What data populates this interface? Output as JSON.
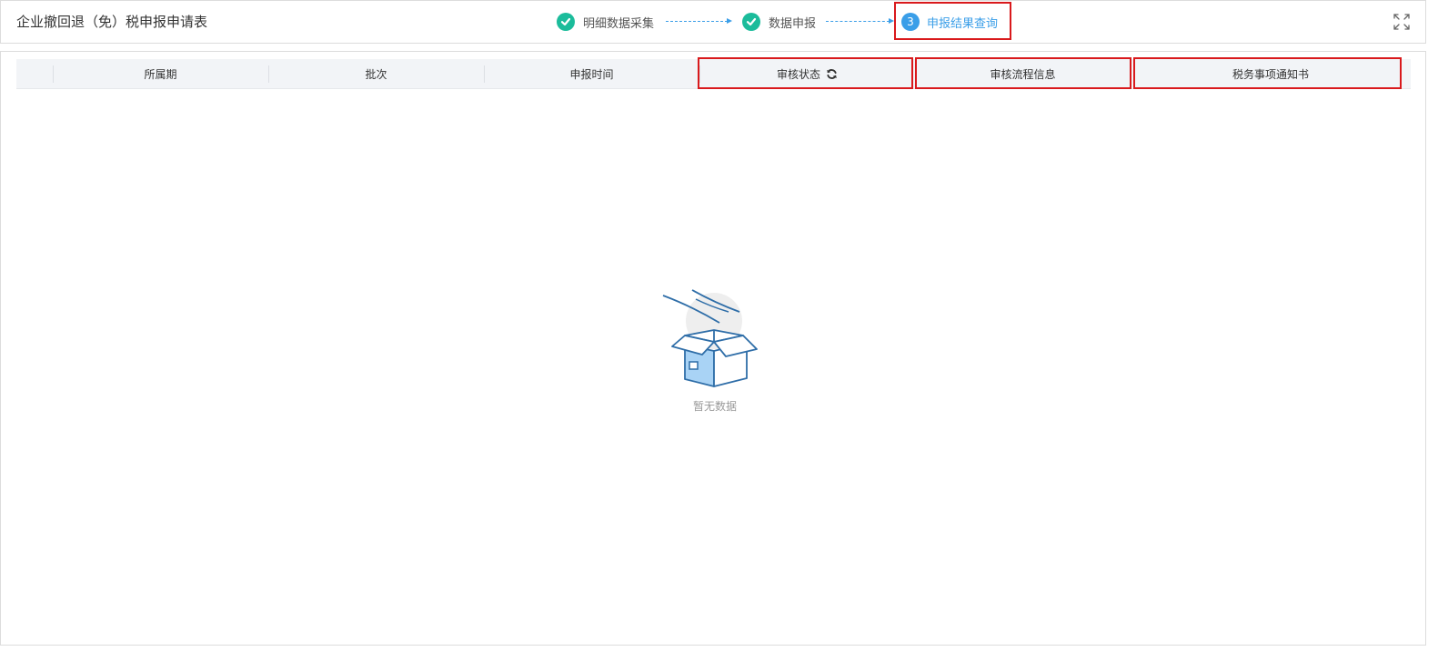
{
  "header": {
    "title": "企业撤回退（免）税申报申请表",
    "steps": [
      {
        "label": "明细数据采集",
        "state": "done"
      },
      {
        "label": "数据申报",
        "state": "done"
      },
      {
        "label": "申报结果查询",
        "state": "active",
        "number": "3"
      }
    ],
    "expand_icon": "fullscreen-icon"
  },
  "table": {
    "columns": [
      "所属期",
      "批次",
      "申报时间",
      "审核状态",
      "审核流程信息",
      "税务事项通知书"
    ],
    "refresh_icon": "refresh-icon",
    "rows": []
  },
  "empty_state": {
    "text": "暂无数据",
    "icon": "empty-box-icon"
  },
  "colors": {
    "done": "#1bbc9b",
    "active": "#3a9ee8",
    "highlight": "#d9191c",
    "header_bg": "#f2f4f7"
  }
}
